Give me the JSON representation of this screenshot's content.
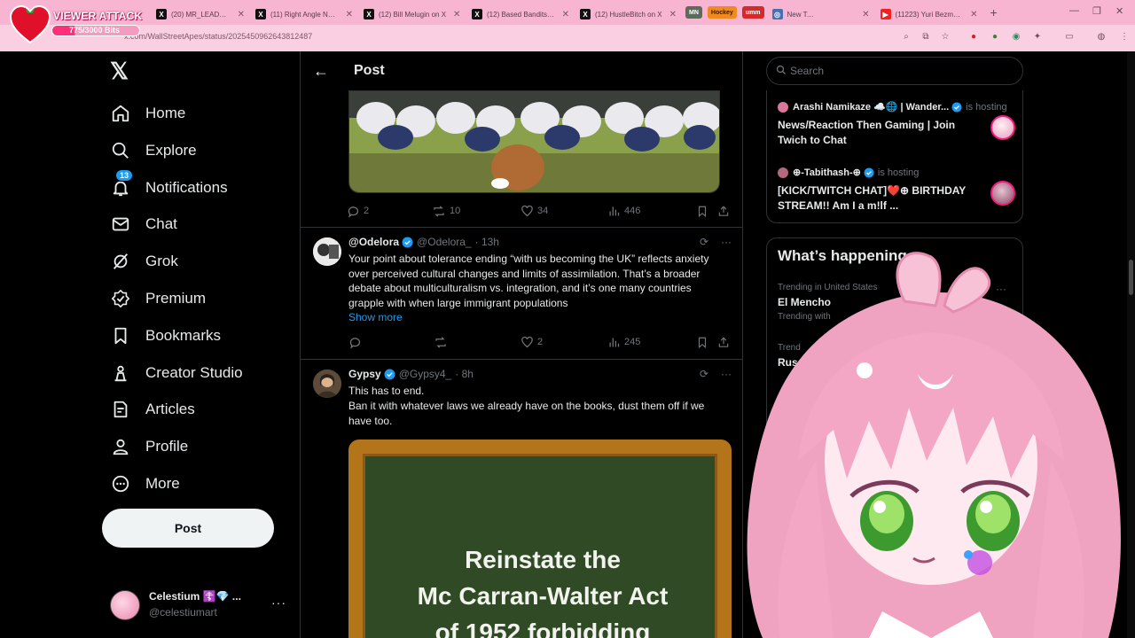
{
  "overlay": {
    "title": "VIEWER ATTACK",
    "bits": "775/3000 Bits",
    "progress_fraction": 0.258
  },
  "browser": {
    "tabs": [
      {
        "label": "(20) MR_LEADSLINGER",
        "icon": "x-icon"
      },
      {
        "label": "(11) Right Angle News",
        "icon": "x-icon"
      },
      {
        "label": "(12) Bill Melugin on X",
        "icon": "x-icon"
      },
      {
        "label": "(12) Based Bandits on X",
        "icon": "x-icon"
      },
      {
        "label": "(12) HustleBitch on X",
        "icon": "x-icon"
      }
    ],
    "pills": [
      "MN",
      "Hockey",
      "umm"
    ],
    "new_tab": "New Tab",
    "youtube_tab": "(11223) Yuri Bezmenov",
    "url": "x.com/WallStreetApes/status/2025450962643812487"
  },
  "nav": {
    "items": [
      {
        "label": "Home",
        "icon": "home-icon"
      },
      {
        "label": "Explore",
        "icon": "search-icon"
      },
      {
        "label": "Notifications",
        "icon": "bell-icon",
        "badge": "13"
      },
      {
        "label": "Chat",
        "icon": "mail-icon"
      },
      {
        "label": "Grok",
        "icon": "grok-icon"
      },
      {
        "label": "Premium",
        "icon": "premium-icon"
      },
      {
        "label": "Bookmarks",
        "icon": "bookmark-icon"
      },
      {
        "label": "Creator Studio",
        "icon": "creator-studio-icon"
      },
      {
        "label": "Articles",
        "icon": "articles-icon"
      },
      {
        "label": "Profile",
        "icon": "person-icon"
      },
      {
        "label": "More",
        "icon": "more-circle-icon"
      }
    ],
    "post_label": "Post",
    "account": {
      "name": "Celestium ☦️💎 ...",
      "handle": "@celestiumart"
    }
  },
  "main": {
    "title": "Post",
    "first_post_stats": {
      "replies": "2",
      "reposts": "10",
      "likes": "34",
      "views": "446"
    },
    "replies": [
      {
        "name": "@Odelora",
        "handle": "@Odelora_",
        "time": "· 13h",
        "text": "Your point about tolerance ending “with us becoming the UK” reflects anxiety over perceived cultural changes and limits of assimilation. That’s a broader debate about multiculturalism vs. integration, and it’s one many countries grapple with when large immigrant populations",
        "show_more": "Show more",
        "stats": {
          "replies": "",
          "reposts": "",
          "likes": "2",
          "views": "245"
        }
      },
      {
        "name": "Gypsy",
        "handle": "@Gypsy4_",
        "time": "· 8h",
        "text_line1": "This has to end.",
        "text_line2": "Ban it with whatever laws we already have on the books, dust them off if we have too.",
        "image_text": [
          "Reinstate the",
          "Mc Carran-Walter Act",
          "of 1952 forbidding"
        ]
      }
    ]
  },
  "right": {
    "search_placeholder": "Search",
    "live": [
      {
        "user": "Arashi Namikaze ☁️🌐 | Wander...",
        "status": "is hosting",
        "title": "News/Reaction Then Gaming | Join Twich to Chat"
      },
      {
        "user": "⊕-Tabithash-⊕",
        "status": "is hosting",
        "title": "[KICK/TWITCH CHAT]❤️⊕ BIRTHDAY STREAM!! Am I a m!lf ..."
      }
    ],
    "happening_title": "What’s happening",
    "trends": [
      {
        "context": "Trending in United States",
        "name": "El Mencho",
        "sub": "Trending with"
      },
      {
        "context": "Trend",
        "name": "Rus"
      }
    ]
  },
  "colors": {
    "accent": "#1d9bf0",
    "tabbar": "#f7b5d2",
    "background": "#000000"
  }
}
